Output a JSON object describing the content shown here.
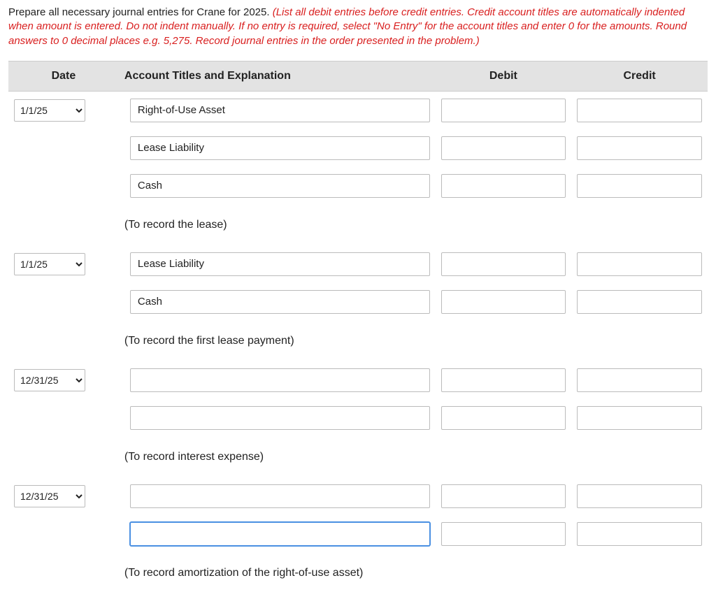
{
  "instructions": {
    "part1": "Prepare all necessary journal entries for Crane for 2025. ",
    "part2": "(List all debit entries before credit entries. Credit account titles are automatically indented when amount is entered. Do not indent manually. If no entry is required, select \"No Entry\" for the account titles and enter 0 for the amounts. Round answers to 0 decimal places e.g. 5,275. Record journal entries in the order presented in the problem.)"
  },
  "headers": {
    "date": "Date",
    "acct": "Account Titles and Explanation",
    "debit": "Debit",
    "credit": "Credit"
  },
  "dates": {
    "d1": "1/1/25",
    "d2": "1/1/25",
    "d3": "12/31/25",
    "d4": "12/31/25"
  },
  "accts": {
    "e1r1": "Right-of-Use Asset",
    "e1r2": "Lease Liability",
    "e1r3": "Cash",
    "e1exp": "(To record the lease)",
    "e2r1": "Lease Liability",
    "e2r2": "Cash",
    "e2exp": "(To record the first lease payment)",
    "e3r1": "",
    "e3r2": "",
    "e3exp": "(To record interest expense)",
    "e4r1": "",
    "e4r2": "",
    "e4exp": "(To record amortization of the right-of-use asset)"
  }
}
